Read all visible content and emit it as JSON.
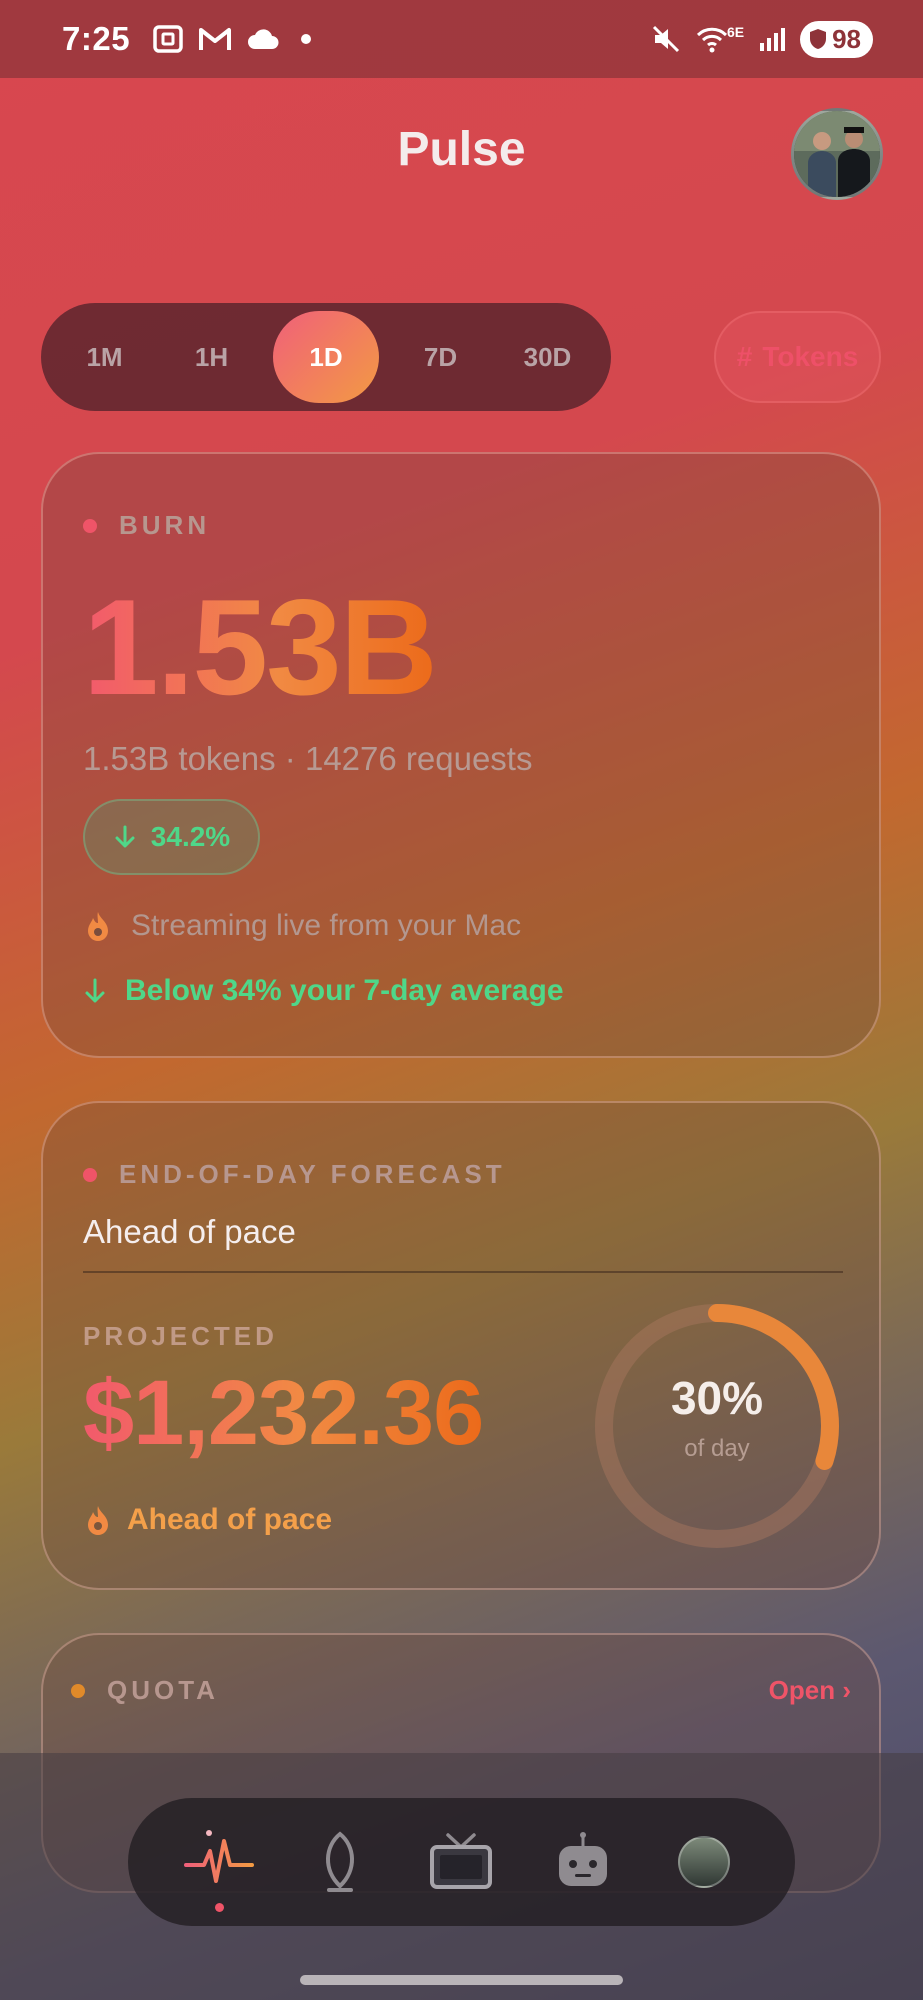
{
  "status_bar": {
    "time": "7:25",
    "battery": "98",
    "network_label": "6E"
  },
  "header": {
    "title": "Pulse"
  },
  "range_selector": {
    "options": [
      "1M",
      "1H",
      "1D",
      "7D",
      "30D"
    ],
    "selected": "1D"
  },
  "metric_toggle": {
    "icon": "#",
    "label": "Tokens"
  },
  "burn_card": {
    "label": "BURN",
    "value": "1.53B",
    "subtitle": "1.53B tokens · 14276 requests",
    "change": "34.2%",
    "streaming_text": "Streaming live from your Mac",
    "comparison_text": "Below 34% your 7-day average"
  },
  "forecast_card": {
    "label": "END-OF-DAY FORECAST",
    "status": "Ahead of pace",
    "projected_label": "PROJECTED",
    "projected_amount": "$1,232.36",
    "pace_text": "Ahead of pace",
    "day_progress_percent": 30,
    "day_progress_text": "30%",
    "day_progress_sub": "of day"
  },
  "quota_card": {
    "label": "QUOTA",
    "open_label": "Open ›"
  },
  "bottom_nav": {
    "items": [
      "pulse",
      "leaf",
      "tv",
      "agent",
      "profile"
    ],
    "active": "pulse"
  },
  "colors": {
    "accent": "#ef5468",
    "accent_orange": "#f18a43",
    "positive": "#4fd789"
  }
}
